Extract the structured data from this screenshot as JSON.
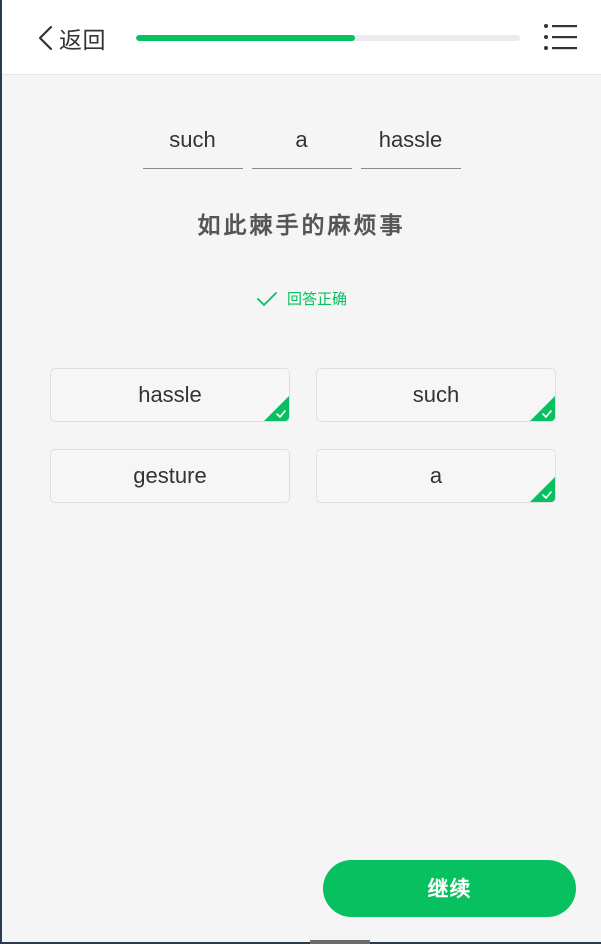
{
  "header": {
    "back_label": "返回",
    "progress": 0.57
  },
  "question": {
    "slots": [
      "such",
      "a",
      "hassle"
    ],
    "translation": "如此棘手的麻烦事"
  },
  "result": {
    "text": "回答正确",
    "color": "#07c160"
  },
  "options": [
    {
      "label": "hassle",
      "used": true
    },
    {
      "label": "such",
      "used": true
    },
    {
      "label": "gesture",
      "used": false
    },
    {
      "label": "a",
      "used": true
    }
  ],
  "footer": {
    "continue_label": "继续"
  },
  "colors": {
    "accent": "#07c160",
    "text": "#333333",
    "background": "#f5f5f5"
  }
}
